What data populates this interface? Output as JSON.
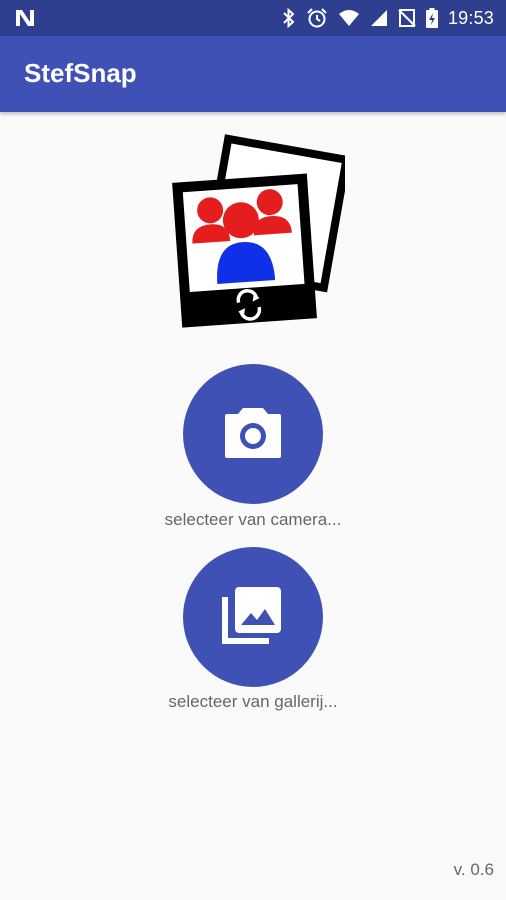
{
  "status_bar": {
    "time": "19:53",
    "icons": [
      "notification-n-icon",
      "bluetooth-icon",
      "alarm-icon",
      "wifi-icon",
      "signal-icon",
      "no-sim-icon",
      "battery-charging-icon"
    ]
  },
  "app_bar": {
    "title": "StefSnap"
  },
  "main": {
    "logo_icon": "stefsnap-logo-icon",
    "camera_button": {
      "icon": "camera-icon",
      "label": "selecteer van camera..."
    },
    "gallery_button": {
      "icon": "gallery-icon",
      "label": "selecteer van gallerij..."
    }
  },
  "footer": {
    "version": "v. 0.6"
  },
  "colors": {
    "primary": "#3f51b5",
    "primary_dark": "#2f3f8f",
    "background": "#fafafa",
    "label_text": "#666666"
  }
}
